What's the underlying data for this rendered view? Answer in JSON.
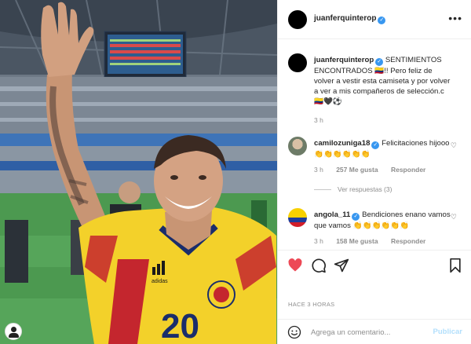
{
  "post": {
    "username": "juanferquinterop",
    "verified": true
  },
  "caption": {
    "username": "juanferquinterop",
    "text": "SENTIMIENTOS ENCONTRADOS 🇨🇴!! Pero feliz de volver a vestir esta camiseta y por volver a ver a mis compañeros de selección.c🇨🇴🖤⚽",
    "time": "3 h"
  },
  "comments": [
    {
      "username": "camilozuniga18",
      "text": "Felicitaciones hijooo 👏👏👏👏👏👏",
      "time": "3 h",
      "likes": "257 Me gusta",
      "reply_label": "Responder",
      "view_replies": "Ver respuestas (3)"
    },
    {
      "username": "angola_11",
      "text": "Bendiciones enano vamos que vamos 👏👏👏👏👏👏",
      "time": "3 h",
      "likes": "158 Me gusta",
      "reply_label": "Responder"
    }
  ],
  "timestamp": "HACE 3 HORAS",
  "add_comment": {
    "placeholder": "Agrega un comentario...",
    "publish_label": "Publicar"
  },
  "photo": {
    "jersey_number": "20"
  },
  "colors": {
    "verified_blue": "#3897f0",
    "like_red": "#ed4956",
    "publish_disabled": "#b2dffc",
    "muted_text": "#8e8e8e"
  },
  "icons": [
    "more-options-icon",
    "verified-icon",
    "heart-icon",
    "comment-icon",
    "share-icon",
    "bookmark-icon",
    "emoji-icon"
  ]
}
